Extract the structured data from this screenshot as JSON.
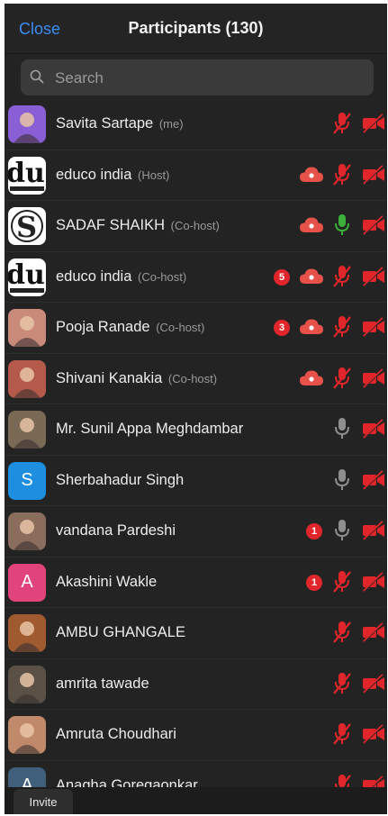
{
  "header": {
    "close_label": "Close",
    "title": "Participants (130)"
  },
  "search": {
    "placeholder": "Search"
  },
  "colors": {
    "accent": "#3b8cf2",
    "muted_red": "#e0262a",
    "active_mic": "#3bb13b",
    "mic_gray": "#8e8e8e"
  },
  "participants": [
    {
      "name": "Savita Sartape",
      "role": "(me)",
      "avatar": "photo",
      "avatar_color": "#8a5fd6",
      "badge": "",
      "cloud": false,
      "mic": "muted",
      "video": "off"
    },
    {
      "name": "educo india",
      "role": "(Host)",
      "avatar": "educo-logo",
      "badge": "",
      "cloud": true,
      "mic": "muted",
      "video": "off"
    },
    {
      "name": "SADAF SHAIKH",
      "role": "(Co-host)",
      "avatar": "s-logo",
      "badge": "",
      "cloud": true,
      "mic": "on",
      "video": "off"
    },
    {
      "name": "educo india",
      "role": "(Co-host)",
      "avatar": "educo-logo",
      "badge": "5",
      "cloud": true,
      "mic": "muted",
      "video": "off"
    },
    {
      "name": "Pooja Ranade",
      "role": "(Co-host)",
      "avatar": "photo",
      "avatar_color": "#c98a7a",
      "badge": "3",
      "cloud": true,
      "mic": "muted",
      "video": "off"
    },
    {
      "name": "Shivani Kanakia",
      "role": "(Co-host)",
      "avatar": "photo",
      "avatar_color": "#b55a4a",
      "badge": "",
      "cloud": true,
      "mic": "muted",
      "video": "off"
    },
    {
      "name": "Mr. Sunil Appa Meghdambar",
      "role": "",
      "avatar": "photo",
      "avatar_color": "#7a6a55",
      "badge": "",
      "cloud": false,
      "mic": "gray",
      "video": "off"
    },
    {
      "name": "Sherbahadur Singh",
      "role": "",
      "avatar": "letter",
      "letter": "S",
      "avatar_color": "#1e8fe0",
      "badge": "",
      "cloud": false,
      "mic": "gray",
      "video": "off"
    },
    {
      "name": "vandana Pardeshi",
      "role": "",
      "avatar": "photo",
      "avatar_color": "#8b6d5d",
      "badge": "1",
      "cloud": false,
      "mic": "gray",
      "video": "off"
    },
    {
      "name": "Akashini Wakle",
      "role": "",
      "avatar": "letter",
      "letter": "A",
      "avatar_color": "#e0447a",
      "badge": "1",
      "cloud": false,
      "mic": "muted",
      "video": "off"
    },
    {
      "name": "AMBU GHANGALE",
      "role": "",
      "avatar": "photo",
      "avatar_color": "#a05a30",
      "badge": "",
      "cloud": false,
      "mic": "muted",
      "video": "off"
    },
    {
      "name": "amrita tawade",
      "role": "",
      "avatar": "photo",
      "avatar_color": "#5a5045",
      "badge": "",
      "cloud": false,
      "mic": "muted",
      "video": "off"
    },
    {
      "name": "Amruta Choudhari",
      "role": "",
      "avatar": "photo",
      "avatar_color": "#c08a6a",
      "badge": "",
      "cloud": false,
      "mic": "muted",
      "video": "off"
    },
    {
      "name": "Anagha Goregaonkar",
      "role": "",
      "avatar": "letter",
      "letter": "A",
      "avatar_color": "#3f5f7a",
      "badge": "",
      "cloud": false,
      "mic": "muted",
      "video": "off"
    }
  ],
  "footer": {
    "invite_label": "Invite"
  }
}
